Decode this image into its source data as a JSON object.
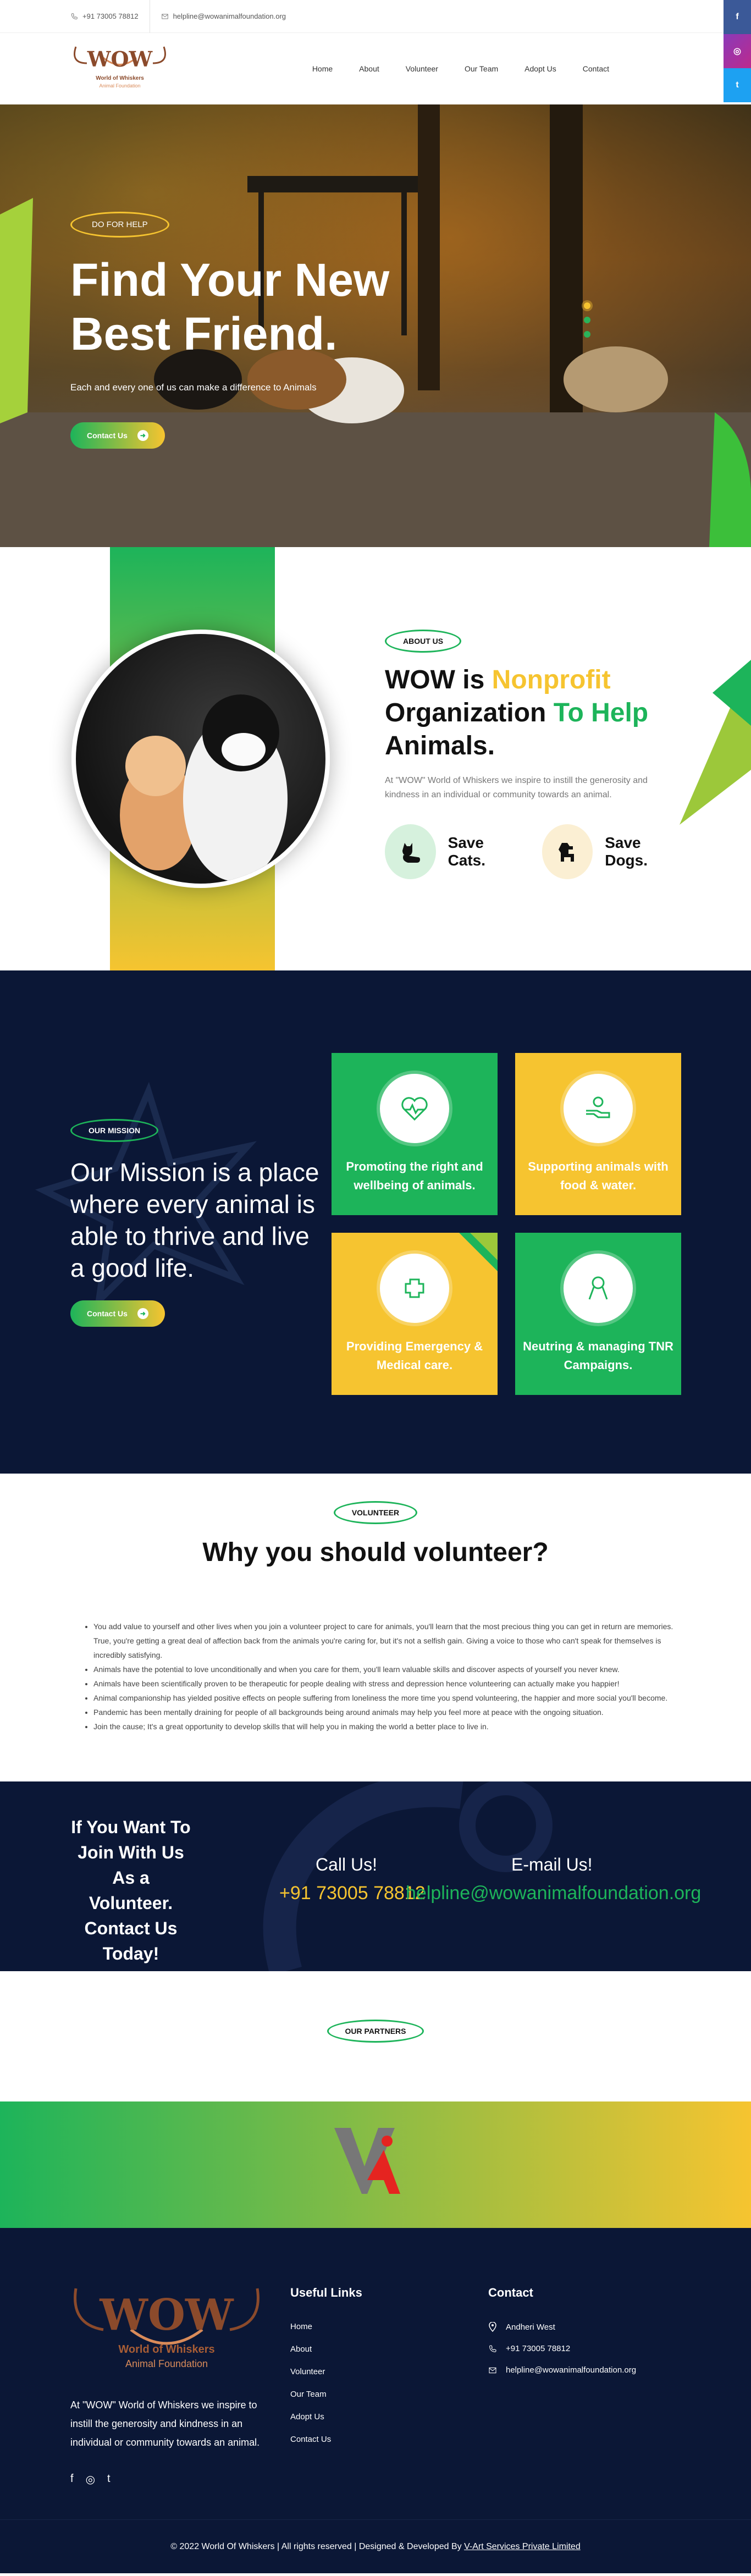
{
  "topbar": {
    "phone": "+91 73005 78812",
    "email": "helpline@wowanimalfoundation.org"
  },
  "social_fixed": {
    "facebook": "f",
    "instagram": "◎",
    "twitter": "t"
  },
  "colors": {
    "green": "#1db45a",
    "yellow": "#f6c430",
    "navy": "#0b1736",
    "brown": "#8b4a2b"
  },
  "logo": {
    "word": "WOW",
    "line1": "World of Whiskers",
    "line2": "Animal Foundation"
  },
  "nav": [
    "Home",
    "About",
    "Volunteer",
    "Our Team",
    "Adopt Us",
    "Contact"
  ],
  "hero": {
    "tag": "DO FOR HELP",
    "title_line1": "Find Your New",
    "title_line2": "Best Friend.",
    "subtitle": "Each and every one of us can make a difference to Animals",
    "button": "Contact Us"
  },
  "about": {
    "tag": "ABOUT US",
    "title_a": "WOW is ",
    "title_b": "Nonprofit",
    "title_c": "Organization ",
    "title_d": "To Help",
    "title_e": "Animals.",
    "text": "At \"WOW\" World of Whiskers we inspire to instill the generosity and kindness in an individual or community towards an animal.",
    "pet1": "Save Cats.",
    "pet2": "Save Dogs."
  },
  "mission": {
    "tag": "OUR MISSION",
    "title": "Our Mission is a place where every animal is able to thrive and live a good life.",
    "button": "Contact Us",
    "cards": [
      {
        "title": "Promoting the right and wellbeing of animals.",
        "icon": "heart-pulse-icon"
      },
      {
        "title": "Supporting animals with food & water.",
        "icon": "hand-food-icon"
      },
      {
        "title": "Providing Emergency & Medical care.",
        "icon": "medical-care-icon"
      },
      {
        "title": "Neutring & managing TNR Campaigns.",
        "icon": "tnr-ribbon-icon"
      }
    ]
  },
  "volunteer": {
    "tag": "VOLUNTEER",
    "title": "Why you should volunteer?",
    "points": [
      "You add value to yourself and other lives when you join a volunteer project to care for animals, you'll learn that the most precious thing you can get in return are memories. True, you're getting a great deal of affection back from the animals you're caring for, but it's not a selfish gain. Giving a voice to those who can't speak for themselves is incredibly satisfying.",
      "Animals have the potential to love unconditionally and when you care for them, you'll learn valuable skills and discover aspects of yourself you never knew.",
      "Animals have been scientifically proven to be therapeutic for people dealing with stress and depression hence volunteering can actually make you happier!",
      "Animal companionship has yielded positive effects on people suffering from loneliness the more time you spend volunteering, the happier and more social you'll become.",
      "Pandemic has been mentally draining for people of all backgrounds being around animals may help you feel more at peace with the ongoing situation.",
      "Join the cause; It's a great opportunity to develop skills that will help you in making the world a better place to live in."
    ]
  },
  "band": {
    "cta": "If You Want To Join With Us As a Volunteer. Contact Us Today!",
    "call_label": "Call Us!",
    "call_value": "+91 73005 78812",
    "email_label": "E-mail Us!",
    "email_value": "helpline@wowanimalfoundation.org"
  },
  "partners": {
    "tag": "OUR PARTNERS"
  },
  "footer": {
    "desc": "At \"WOW\" World of Whiskers we inspire to instill the generosity and kindness in an individual or community towards an animal.",
    "useful_title": "Useful Links",
    "links": [
      "Home",
      "About",
      "Volunteer",
      "Our Team",
      "Adopt Us",
      "Contact Us"
    ],
    "contact_title": "Contact",
    "address": "Andheri West",
    "phone": "+91 73005 78812",
    "email": "helpline@wowanimalfoundation.org"
  },
  "copyright": {
    "text": "© 2022 World Of Whiskers | All rights reserved | Designed & Developed By ",
    "developer": "V-Art Services Private Limited"
  }
}
